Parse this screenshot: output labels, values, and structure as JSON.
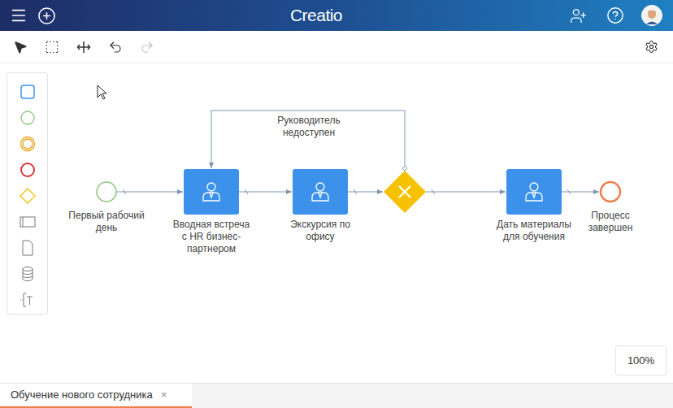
{
  "header": {
    "logo": "Creatio"
  },
  "toolbar": {
    "buttons": [
      {
        "disabled": false
      },
      {
        "disabled": false
      },
      {
        "disabled": false
      },
      {
        "disabled": false
      },
      {
        "disabled": true
      }
    ]
  },
  "diagram": {
    "nodes": [
      {
        "kind": "start",
        "label_lines": [
          "Первый рабочий",
          "день"
        ]
      },
      {
        "kind": "task",
        "label_lines": [
          "Вводная встреча",
          "с HR бизнес-",
          "партнером"
        ]
      },
      {
        "kind": "task",
        "label_lines": [
          "Экскурсия по",
          "офису"
        ]
      },
      {
        "kind": "gateway",
        "label_lines": []
      },
      {
        "kind": "task",
        "label_lines": [
          "Дать материалы",
          "для обучения"
        ]
      },
      {
        "kind": "end",
        "label_lines": [
          "Процесс",
          "завершен"
        ]
      }
    ],
    "loop_flow": {
      "label_lines": [
        "Руководитель",
        "недоступен"
      ]
    }
  },
  "zoom": "100%",
  "tabs": [
    {
      "label": "Обучение нового сотрудника",
      "selected": true,
      "close": "×"
    }
  ]
}
